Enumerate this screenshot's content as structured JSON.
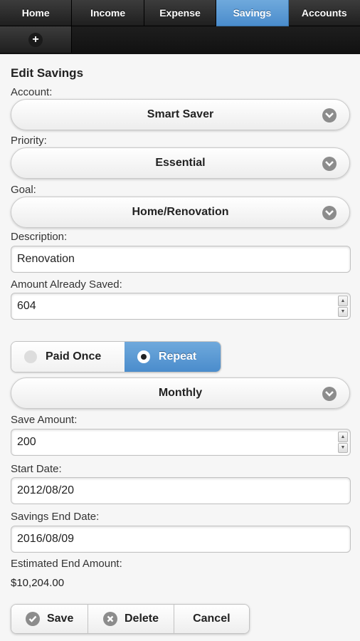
{
  "nav": {
    "tabs": [
      {
        "label": "Home"
      },
      {
        "label": "Income"
      },
      {
        "label": "Expense"
      },
      {
        "label": "Savings"
      },
      {
        "label": "Accounts"
      }
    ],
    "active_tab": "Savings",
    "add_icon": "plus-icon"
  },
  "form": {
    "title": "Edit Savings",
    "account": {
      "label": "Account:",
      "value": "Smart Saver"
    },
    "priority": {
      "label": "Priority:",
      "value": "Essential"
    },
    "goal": {
      "label": "Goal:",
      "value": "Home/Renovation"
    },
    "description": {
      "label": "Description:",
      "value": "Renovation"
    },
    "amount_saved": {
      "label": "Amount Already Saved:",
      "value": "604"
    },
    "frequency_mode": {
      "options": [
        "Paid Once",
        "Repeat"
      ],
      "selected": "Repeat"
    },
    "frequency": {
      "value": "Monthly"
    },
    "save_amount": {
      "label": "Save Amount:",
      "value": "200"
    },
    "start_date": {
      "label": "Start Date:",
      "value": "2012/08/20"
    },
    "end_date": {
      "label": "Savings End Date:",
      "value": "2016/08/09"
    },
    "estimated": {
      "label": "Estimated End Amount:",
      "value": "$10,204.00"
    }
  },
  "actions": {
    "save_label": "Save",
    "delete_label": "Delete",
    "cancel_label": "Cancel"
  },
  "colors": {
    "active_tab": "#5a9ad6",
    "nav_bg": "#1f1f1f",
    "icon_gray": "#8c8c8c"
  }
}
